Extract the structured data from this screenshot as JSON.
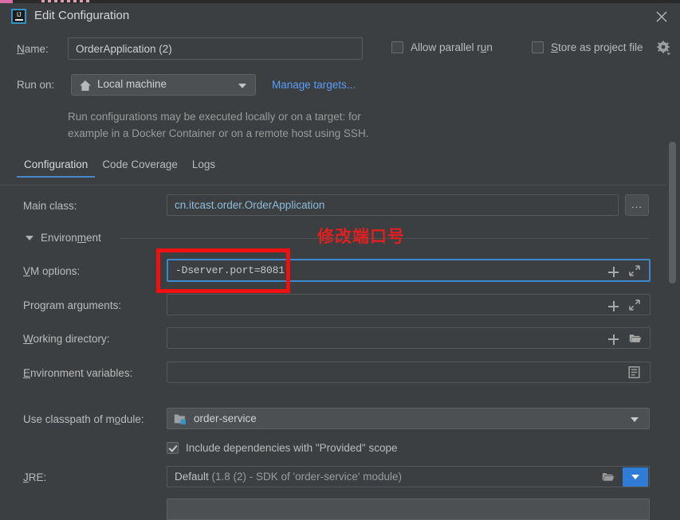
{
  "window": {
    "title": "Edit Configuration",
    "app_icon": "intellij-idea-icon",
    "close_icon": "close-icon"
  },
  "header": {
    "name_label": "Name:",
    "name_label_mnemonic": "N",
    "name_value": "OrderApplication (2)",
    "allow_parallel_run": {
      "label_pre": "Allow parallel r",
      "label_mn": "u",
      "label_post": "n",
      "checked": false
    },
    "store_as_project_file": {
      "label_mn": "S",
      "label_post": "tore as project file",
      "checked": false
    },
    "gear_icon": "gear-icon",
    "run_on_label": "Run on:",
    "run_on_value": "Local machine",
    "run_on_icon": "home-icon",
    "manage_targets_link": "Manage targets...",
    "description_line1": "Run configurations may be executed locally or on a target: for",
    "description_line2": "example in a Docker Container or on a remote host using SSH."
  },
  "tabs": [
    {
      "label": "Configuration",
      "active": true
    },
    {
      "label": "Code Coverage",
      "active": false
    },
    {
      "label": "Logs",
      "active": false
    }
  ],
  "form": {
    "main_class": {
      "label": "Main class:",
      "value": "cn.itcast.order.OrderApplication",
      "browse_button": "...",
      "value_color": "#8fbcdb"
    },
    "environment_section": {
      "label_pre": "Environ",
      "label_mn": "m",
      "label_post": "ent",
      "expanded": true
    },
    "vm_options": {
      "label_mn": "V",
      "label_post": "M options:",
      "value": "-Dserver.port=8081",
      "focused": true,
      "icons": [
        "plus-icon",
        "expand-icon"
      ]
    },
    "program_arguments": {
      "label_pre": "Program ar",
      "label_mn": "g",
      "label_post": "uments:",
      "value": "",
      "icons": [
        "plus-icon",
        "expand-icon"
      ]
    },
    "working_directory": {
      "label_mn": "W",
      "label_post": "orking directory:",
      "value": "",
      "icons": [
        "plus-icon",
        "folder-icon"
      ]
    },
    "environment_variables": {
      "label_mn": "E",
      "label_post": "nvironment variables:",
      "value": "",
      "icons": [
        "list-icon"
      ]
    },
    "use_classpath_of_module": {
      "label_pre": "Use classpath of m",
      "label_mn": "o",
      "label_post": "dule:",
      "value": "order-service",
      "icon": "module-folder-icon"
    },
    "include_provided_scope": {
      "label": "Include dependencies with \"Provided\" scope",
      "checked": true
    },
    "jre": {
      "label_mn": "J",
      "label_post": "RE:",
      "value_main": "Default",
      "value_detail": " (1.8 (2) - SDK of 'order-service' module)",
      "folder_icon": "folder-icon",
      "dropdown_icon": "chevron-down-icon"
    }
  },
  "annotation": {
    "text": "修改端口号",
    "color": "#e02020",
    "highlight_target": "vm-options-input"
  },
  "colors": {
    "dialog_bg": "#3c3f41",
    "accent_blue": "#3e88cf",
    "link_blue": "#589df6",
    "tab_underline": "#4a88c7",
    "annotation_red": "#f01010",
    "jre_dropdown_blue": "#2e7cd6"
  }
}
